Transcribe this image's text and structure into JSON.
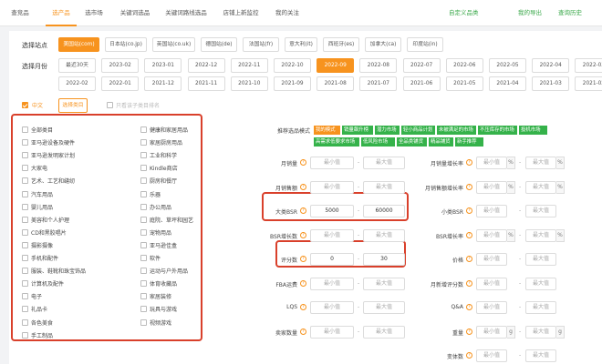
{
  "nav": {
    "tabs": [
      "查竞品",
      "选产品",
      "选市场",
      "关键词选品",
      "关键词路线选品",
      "店铺上新监控",
      "我的关注"
    ],
    "active_index": 1,
    "right_links": [
      "自定义品类",
      "我的导出",
      "查询历史"
    ]
  },
  "site": {
    "label": "选择站点",
    "options": [
      "美国站(com)",
      "日本站(co.jp)",
      "英国站(co.uk)",
      "德国站(de)",
      "法国站(fr)",
      "意大利(it)",
      "西班牙(es)",
      "加拿大(ca)",
      "印度站(in)"
    ],
    "selected_index": 0
  },
  "month": {
    "label": "选择月份",
    "row1": [
      "最近30天",
      "2023-02",
      "2023-01",
      "2022-12",
      "2022-11",
      "2022-10",
      "2022-09",
      "2022-08",
      "2022-07",
      "2022-06",
      "2022-05",
      "2022-04",
      "2022-03"
    ],
    "row2": [
      "2022-02",
      "2022-01",
      "2021-12",
      "2021-11",
      "2021-10",
      "2021-09",
      "2021-08",
      "2021-07",
      "2021-06",
      "2021-05",
      "2021-04",
      "2021-03",
      "2021-02"
    ],
    "selected": "2022-09"
  },
  "lang": {
    "label": "中文",
    "checked": true
  },
  "category_button": "选择类目",
  "sub_rank": {
    "label": "只看该子类目排名",
    "checked": false
  },
  "categories": {
    "left": [
      "全部类目",
      "亚马逊设备及硬件",
      "亚马逊发明家计划",
      "大家电",
      "艺术、工艺和缝纫",
      "汽车用品",
      "婴儿用品",
      "美容和个人护理",
      "CD和黑胶唱片",
      "摄影摄像",
      "手机和配件",
      "服装、鞋靴和珠宝饰品",
      "计算机及配件",
      "电子",
      "礼品卡",
      "各色美食",
      "手工制品"
    ],
    "right": [
      "健康和家居用品",
      "家居厨房用品",
      "工业和科学",
      "Kindle商店",
      "厨房和餐厅",
      "乐器",
      "办公用品",
      "庭院、草坪和园艺",
      "宠物用品",
      "亚马逊佳盒",
      "软件",
      "运动与户外用品",
      "体育收藏品",
      "家居装修",
      "玩具与游戏",
      "视频游戏"
    ]
  },
  "mode": {
    "label": "推荐选品模式",
    "tags": [
      "我的模式",
      "销量飙升榜",
      "潜力市场",
      "轻小商品计划",
      "未被满足的市场",
      "不压库存的市场",
      "投机市场",
      "高需求低要求市场",
      "低风险市场",
      "全品类铺货",
      "精品铺货",
      "新手推荐"
    ]
  },
  "placeholders": {
    "min": "最小值",
    "max": "最大值"
  },
  "filters_left": [
    {
      "label": "月销量",
      "min": "",
      "max": ""
    },
    {
      "label": "月销售额",
      "min": "",
      "max": ""
    },
    {
      "label": "大类BSR",
      "min": "5000",
      "max": "60000"
    },
    {
      "label": "BSR增长数",
      "min": "",
      "max": ""
    },
    {
      "label": "评分数",
      "min": "0",
      "max": "30"
    },
    {
      "label": "FBA运费",
      "min": "",
      "max": ""
    },
    {
      "label": "LQS",
      "min": "",
      "max": ""
    },
    {
      "label": "卖家数量",
      "min": "",
      "max": ""
    }
  ],
  "filters_right": [
    {
      "label": "月销量增长率",
      "unit": "%"
    },
    {
      "label": "月销售额增长率",
      "unit": "%"
    },
    {
      "label": "小类BSR",
      "unit": ""
    },
    {
      "label": "BSR增长率",
      "unit": "%"
    },
    {
      "label": "价格",
      "unit": ""
    },
    {
      "label": "月新增评分数",
      "unit": ""
    },
    {
      "label": "Q&A",
      "unit": ""
    },
    {
      "label": "重量",
      "unit": "g"
    },
    {
      "label": "变体数",
      "unit": ""
    }
  ],
  "colors": {
    "accent": "#f7931e",
    "green": "#35b24a",
    "highlight": "#d9402b"
  }
}
